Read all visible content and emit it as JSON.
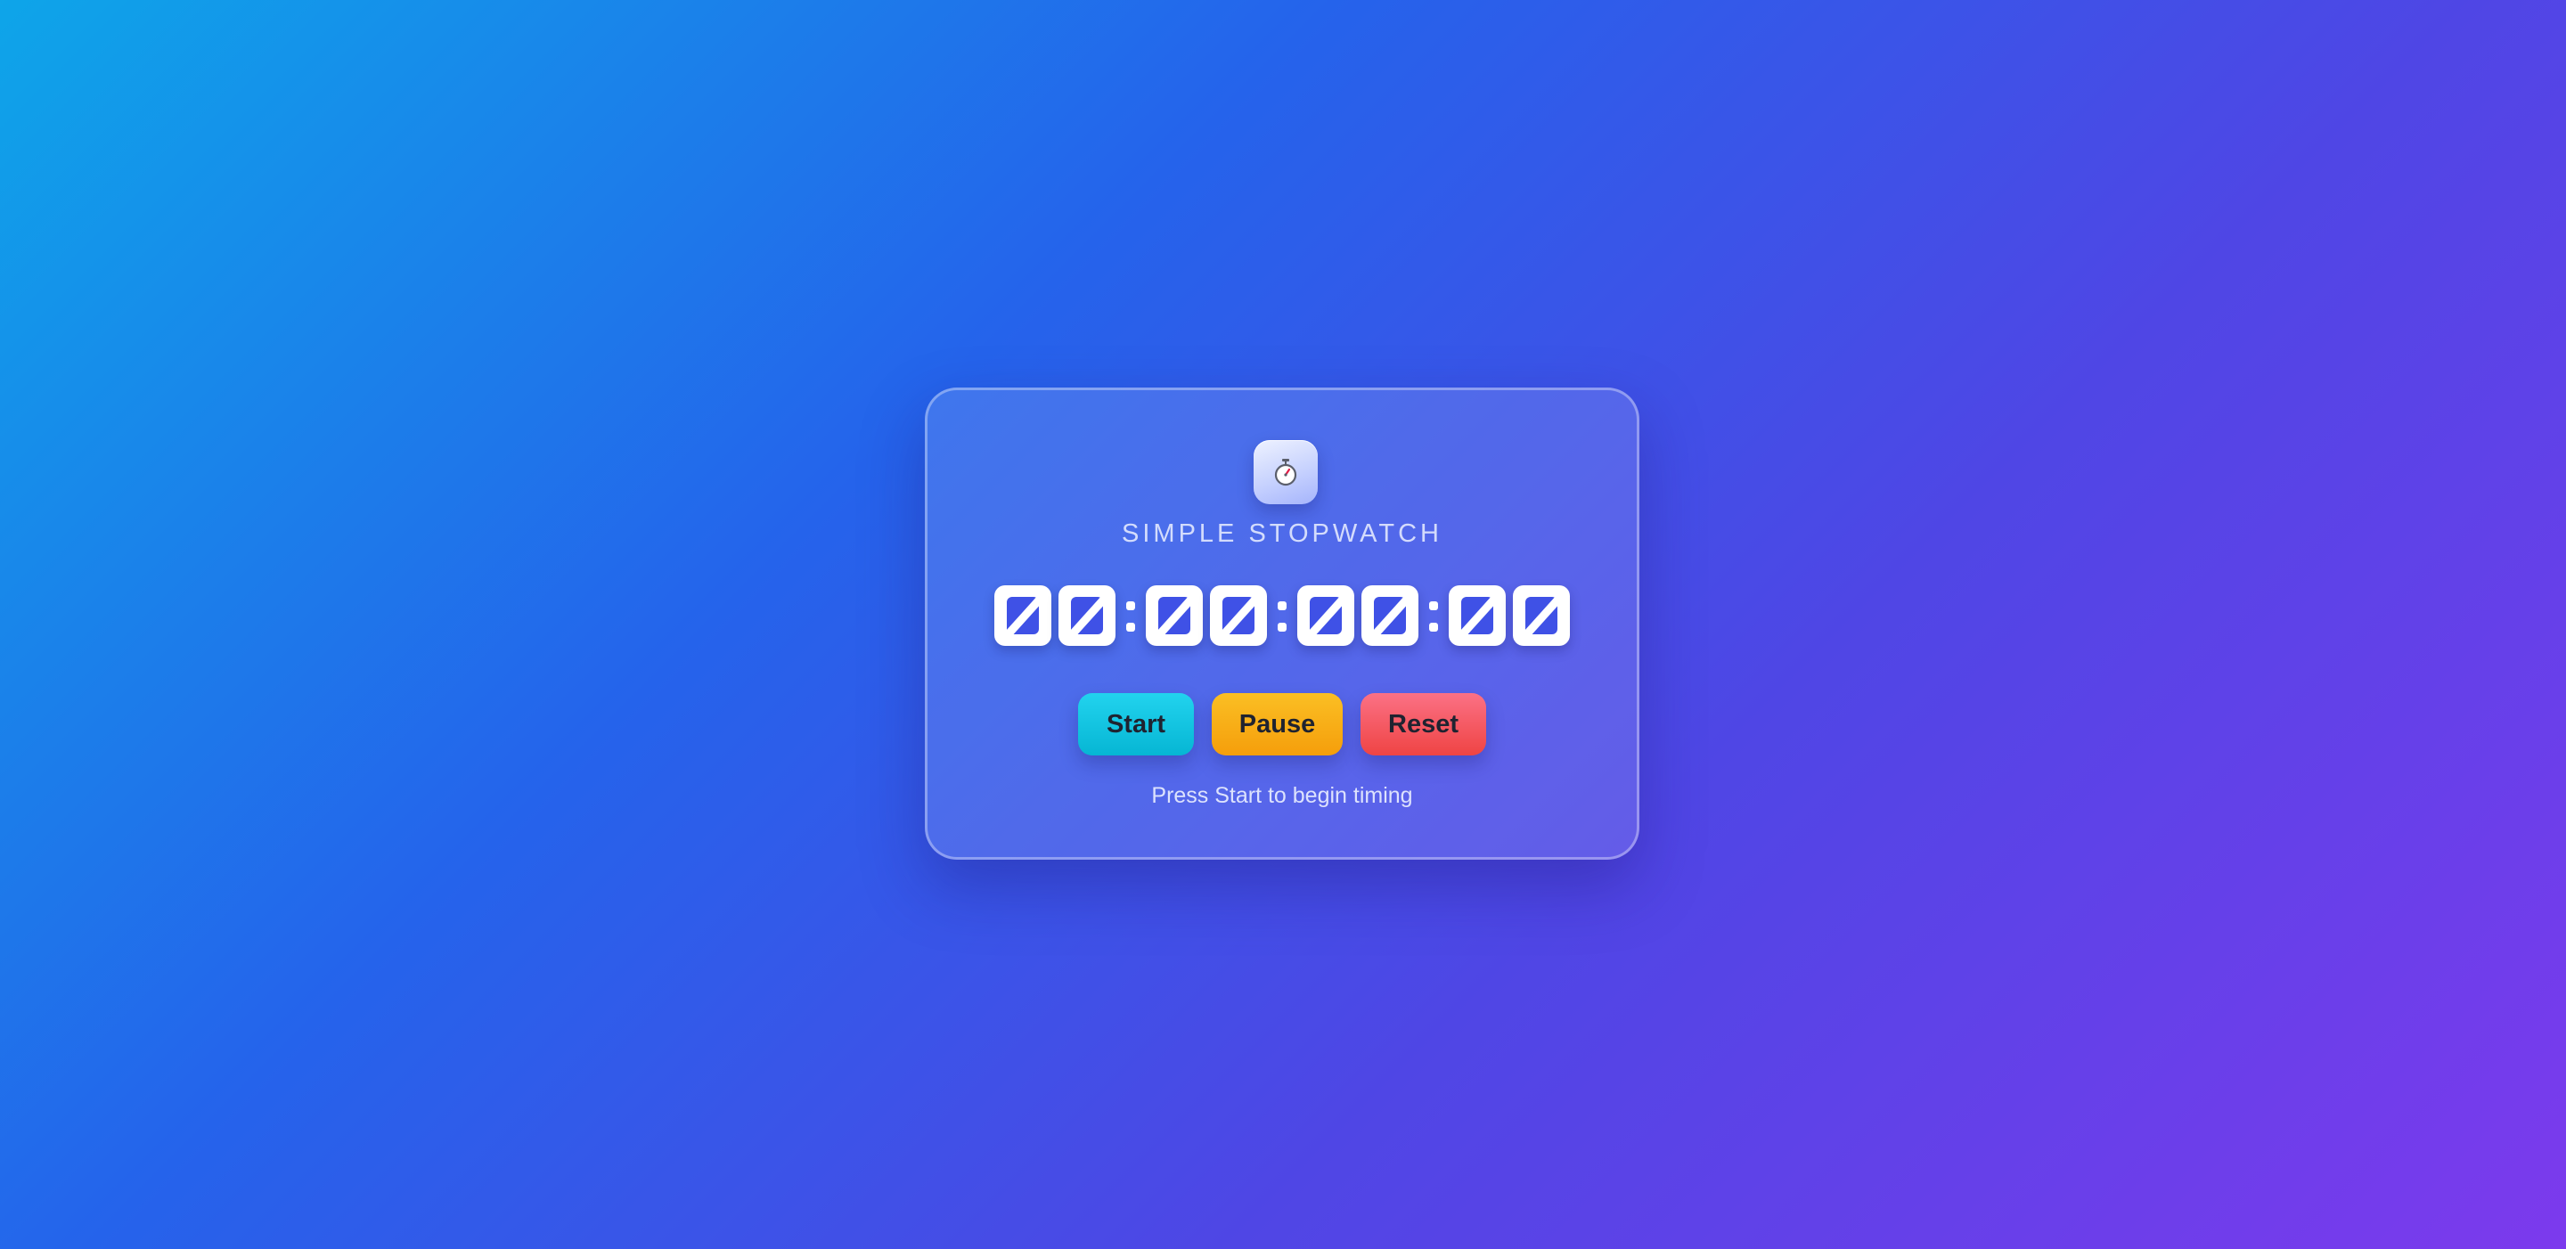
{
  "app": {
    "icon": "stopwatch-icon",
    "title": "SIMPLE STOPWATCH"
  },
  "timer": {
    "display": "00:00:00:00",
    "digits": [
      "0",
      "0",
      "0",
      "0",
      "0",
      "0",
      "0",
      "0"
    ],
    "separator": ":"
  },
  "controls": {
    "start_label": "Start",
    "pause_label": "Pause",
    "reset_label": "Reset"
  },
  "status": {
    "hint": "Press Start to begin timing"
  },
  "colors": {
    "start": "#06b6d4",
    "pause": "#f59e0b",
    "reset": "#ef4444",
    "background_from": "#0ea5e9",
    "background_to": "#7c3aed"
  }
}
